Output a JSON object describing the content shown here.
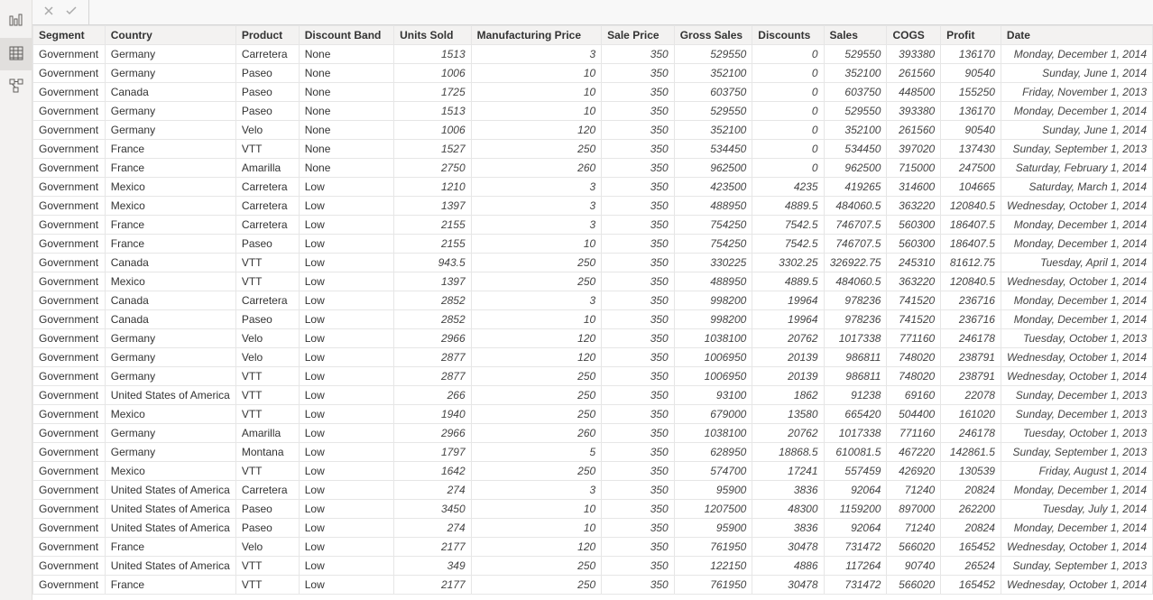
{
  "sidebar": {
    "items": [
      {
        "name": "report-view-icon"
      },
      {
        "name": "data-view-icon"
      },
      {
        "name": "model-view-icon"
      }
    ],
    "activeIndex": 1
  },
  "formula_bar": {
    "cancel_label": "✕",
    "commit_label": "✓",
    "value": ""
  },
  "columns": [
    {
      "key": "segment",
      "label": "Segment",
      "align": "txt"
    },
    {
      "key": "country",
      "label": "Country",
      "align": "txt"
    },
    {
      "key": "product",
      "label": "Product",
      "align": "txt"
    },
    {
      "key": "discount_band",
      "label": "Discount Band",
      "align": "txt"
    },
    {
      "key": "units_sold",
      "label": "Units Sold",
      "align": "num"
    },
    {
      "key": "mfg_price",
      "label": "Manufacturing Price",
      "align": "num"
    },
    {
      "key": "sale_price",
      "label": "Sale Price",
      "align": "num"
    },
    {
      "key": "gross_sales",
      "label": "Gross Sales",
      "align": "num"
    },
    {
      "key": "discounts",
      "label": "Discounts",
      "align": "num"
    },
    {
      "key": "sales",
      "label": "Sales",
      "align": "num"
    },
    {
      "key": "cogs",
      "label": "COGS",
      "align": "num"
    },
    {
      "key": "profit",
      "label": "Profit",
      "align": "num"
    },
    {
      "key": "date",
      "label": "Date",
      "align": "date"
    }
  ],
  "rows": [
    {
      "segment": "Government",
      "country": "Germany",
      "product": "Carretera",
      "discount_band": "None",
      "units_sold": "1513",
      "mfg_price": "3",
      "sale_price": "350",
      "gross_sales": "529550",
      "discounts": "0",
      "sales": "529550",
      "cogs": "393380",
      "profit": "136170",
      "date": "Monday, December 1, 2014"
    },
    {
      "segment": "Government",
      "country": "Germany",
      "product": "Paseo",
      "discount_band": "None",
      "units_sold": "1006",
      "mfg_price": "10",
      "sale_price": "350",
      "gross_sales": "352100",
      "discounts": "0",
      "sales": "352100",
      "cogs": "261560",
      "profit": "90540",
      "date": "Sunday, June 1, 2014"
    },
    {
      "segment": "Government",
      "country": "Canada",
      "product": "Paseo",
      "discount_band": "None",
      "units_sold": "1725",
      "mfg_price": "10",
      "sale_price": "350",
      "gross_sales": "603750",
      "discounts": "0",
      "sales": "603750",
      "cogs": "448500",
      "profit": "155250",
      "date": "Friday, November 1, 2013"
    },
    {
      "segment": "Government",
      "country": "Germany",
      "product": "Paseo",
      "discount_band": "None",
      "units_sold": "1513",
      "mfg_price": "10",
      "sale_price": "350",
      "gross_sales": "529550",
      "discounts": "0",
      "sales": "529550",
      "cogs": "393380",
      "profit": "136170",
      "date": "Monday, December 1, 2014"
    },
    {
      "segment": "Government",
      "country": "Germany",
      "product": "Velo",
      "discount_band": "None",
      "units_sold": "1006",
      "mfg_price": "120",
      "sale_price": "350",
      "gross_sales": "352100",
      "discounts": "0",
      "sales": "352100",
      "cogs": "261560",
      "profit": "90540",
      "date": "Sunday, June 1, 2014"
    },
    {
      "segment": "Government",
      "country": "France",
      "product": "VTT",
      "discount_band": "None",
      "units_sold": "1527",
      "mfg_price": "250",
      "sale_price": "350",
      "gross_sales": "534450",
      "discounts": "0",
      "sales": "534450",
      "cogs": "397020",
      "profit": "137430",
      "date": "Sunday, September 1, 2013"
    },
    {
      "segment": "Government",
      "country": "France",
      "product": "Amarilla",
      "discount_band": "None",
      "units_sold": "2750",
      "mfg_price": "260",
      "sale_price": "350",
      "gross_sales": "962500",
      "discounts": "0",
      "sales": "962500",
      "cogs": "715000",
      "profit": "247500",
      "date": "Saturday, February 1, 2014"
    },
    {
      "segment": "Government",
      "country": "Mexico",
      "product": "Carretera",
      "discount_band": "Low",
      "units_sold": "1210",
      "mfg_price": "3",
      "sale_price": "350",
      "gross_sales": "423500",
      "discounts": "4235",
      "sales": "419265",
      "cogs": "314600",
      "profit": "104665",
      "date": "Saturday, March 1, 2014"
    },
    {
      "segment": "Government",
      "country": "Mexico",
      "product": "Carretera",
      "discount_band": "Low",
      "units_sold": "1397",
      "mfg_price": "3",
      "sale_price": "350",
      "gross_sales": "488950",
      "discounts": "4889.5",
      "sales": "484060.5",
      "cogs": "363220",
      "profit": "120840.5",
      "date": "Wednesday, October 1, 2014"
    },
    {
      "segment": "Government",
      "country": "France",
      "product": "Carretera",
      "discount_band": "Low",
      "units_sold": "2155",
      "mfg_price": "3",
      "sale_price": "350",
      "gross_sales": "754250",
      "discounts": "7542.5",
      "sales": "746707.5",
      "cogs": "560300",
      "profit": "186407.5",
      "date": "Monday, December 1, 2014"
    },
    {
      "segment": "Government",
      "country": "France",
      "product": "Paseo",
      "discount_band": "Low",
      "units_sold": "2155",
      "mfg_price": "10",
      "sale_price": "350",
      "gross_sales": "754250",
      "discounts": "7542.5",
      "sales": "746707.5",
      "cogs": "560300",
      "profit": "186407.5",
      "date": "Monday, December 1, 2014"
    },
    {
      "segment": "Government",
      "country": "Canada",
      "product": "VTT",
      "discount_band": "Low",
      "units_sold": "943.5",
      "mfg_price": "250",
      "sale_price": "350",
      "gross_sales": "330225",
      "discounts": "3302.25",
      "sales": "326922.75",
      "cogs": "245310",
      "profit": "81612.75",
      "date": "Tuesday, April 1, 2014"
    },
    {
      "segment": "Government",
      "country": "Mexico",
      "product": "VTT",
      "discount_band": "Low",
      "units_sold": "1397",
      "mfg_price": "250",
      "sale_price": "350",
      "gross_sales": "488950",
      "discounts": "4889.5",
      "sales": "484060.5",
      "cogs": "363220",
      "profit": "120840.5",
      "date": "Wednesday, October 1, 2014"
    },
    {
      "segment": "Government",
      "country": "Canada",
      "product": "Carretera",
      "discount_band": "Low",
      "units_sold": "2852",
      "mfg_price": "3",
      "sale_price": "350",
      "gross_sales": "998200",
      "discounts": "19964",
      "sales": "978236",
      "cogs": "741520",
      "profit": "236716",
      "date": "Monday, December 1, 2014"
    },
    {
      "segment": "Government",
      "country": "Canada",
      "product": "Paseo",
      "discount_band": "Low",
      "units_sold": "2852",
      "mfg_price": "10",
      "sale_price": "350",
      "gross_sales": "998200",
      "discounts": "19964",
      "sales": "978236",
      "cogs": "741520",
      "profit": "236716",
      "date": "Monday, December 1, 2014"
    },
    {
      "segment": "Government",
      "country": "Germany",
      "product": "Velo",
      "discount_band": "Low",
      "units_sold": "2966",
      "mfg_price": "120",
      "sale_price": "350",
      "gross_sales": "1038100",
      "discounts": "20762",
      "sales": "1017338",
      "cogs": "771160",
      "profit": "246178",
      "date": "Tuesday, October 1, 2013"
    },
    {
      "segment": "Government",
      "country": "Germany",
      "product": "Velo",
      "discount_band": "Low",
      "units_sold": "2877",
      "mfg_price": "120",
      "sale_price": "350",
      "gross_sales": "1006950",
      "discounts": "20139",
      "sales": "986811",
      "cogs": "748020",
      "profit": "238791",
      "date": "Wednesday, October 1, 2014"
    },
    {
      "segment": "Government",
      "country": "Germany",
      "product": "VTT",
      "discount_band": "Low",
      "units_sold": "2877",
      "mfg_price": "250",
      "sale_price": "350",
      "gross_sales": "1006950",
      "discounts": "20139",
      "sales": "986811",
      "cogs": "748020",
      "profit": "238791",
      "date": "Wednesday, October 1, 2014"
    },
    {
      "segment": "Government",
      "country": "United States of America",
      "product": "VTT",
      "discount_band": "Low",
      "units_sold": "266",
      "mfg_price": "250",
      "sale_price": "350",
      "gross_sales": "93100",
      "discounts": "1862",
      "sales": "91238",
      "cogs": "69160",
      "profit": "22078",
      "date": "Sunday, December 1, 2013"
    },
    {
      "segment": "Government",
      "country": "Mexico",
      "product": "VTT",
      "discount_band": "Low",
      "units_sold": "1940",
      "mfg_price": "250",
      "sale_price": "350",
      "gross_sales": "679000",
      "discounts": "13580",
      "sales": "665420",
      "cogs": "504400",
      "profit": "161020",
      "date": "Sunday, December 1, 2013"
    },
    {
      "segment": "Government",
      "country": "Germany",
      "product": "Amarilla",
      "discount_band": "Low",
      "units_sold": "2966",
      "mfg_price": "260",
      "sale_price": "350",
      "gross_sales": "1038100",
      "discounts": "20762",
      "sales": "1017338",
      "cogs": "771160",
      "profit": "246178",
      "date": "Tuesday, October 1, 2013"
    },
    {
      "segment": "Government",
      "country": "Germany",
      "product": "Montana",
      "discount_band": "Low",
      "units_sold": "1797",
      "mfg_price": "5",
      "sale_price": "350",
      "gross_sales": "628950",
      "discounts": "18868.5",
      "sales": "610081.5",
      "cogs": "467220",
      "profit": "142861.5",
      "date": "Sunday, September 1, 2013"
    },
    {
      "segment": "Government",
      "country": "Mexico",
      "product": "VTT",
      "discount_band": "Low",
      "units_sold": "1642",
      "mfg_price": "250",
      "sale_price": "350",
      "gross_sales": "574700",
      "discounts": "17241",
      "sales": "557459",
      "cogs": "426920",
      "profit": "130539",
      "date": "Friday, August 1, 2014"
    },
    {
      "segment": "Government",
      "country": "United States of America",
      "product": "Carretera",
      "discount_band": "Low",
      "units_sold": "274",
      "mfg_price": "3",
      "sale_price": "350",
      "gross_sales": "95900",
      "discounts": "3836",
      "sales": "92064",
      "cogs": "71240",
      "profit": "20824",
      "date": "Monday, December 1, 2014"
    },
    {
      "segment": "Government",
      "country": "United States of America",
      "product": "Paseo",
      "discount_band": "Low",
      "units_sold": "3450",
      "mfg_price": "10",
      "sale_price": "350",
      "gross_sales": "1207500",
      "discounts": "48300",
      "sales": "1159200",
      "cogs": "897000",
      "profit": "262200",
      "date": "Tuesday, July 1, 2014"
    },
    {
      "segment": "Government",
      "country": "United States of America",
      "product": "Paseo",
      "discount_band": "Low",
      "units_sold": "274",
      "mfg_price": "10",
      "sale_price": "350",
      "gross_sales": "95900",
      "discounts": "3836",
      "sales": "92064",
      "cogs": "71240",
      "profit": "20824",
      "date": "Monday, December 1, 2014"
    },
    {
      "segment": "Government",
      "country": "France",
      "product": "Velo",
      "discount_band": "Low",
      "units_sold": "2177",
      "mfg_price": "120",
      "sale_price": "350",
      "gross_sales": "761950",
      "discounts": "30478",
      "sales": "731472",
      "cogs": "566020",
      "profit": "165452",
      "date": "Wednesday, October 1, 2014"
    },
    {
      "segment": "Government",
      "country": "United States of America",
      "product": "VTT",
      "discount_band": "Low",
      "units_sold": "349",
      "mfg_price": "250",
      "sale_price": "350",
      "gross_sales": "122150",
      "discounts": "4886",
      "sales": "117264",
      "cogs": "90740",
      "profit": "26524",
      "date": "Sunday, September 1, 2013"
    },
    {
      "segment": "Government",
      "country": "France",
      "product": "VTT",
      "discount_band": "Low",
      "units_sold": "2177",
      "mfg_price": "250",
      "sale_price": "350",
      "gross_sales": "761950",
      "discounts": "30478",
      "sales": "731472",
      "cogs": "566020",
      "profit": "165452",
      "date": "Wednesday, October 1, 2014"
    }
  ]
}
